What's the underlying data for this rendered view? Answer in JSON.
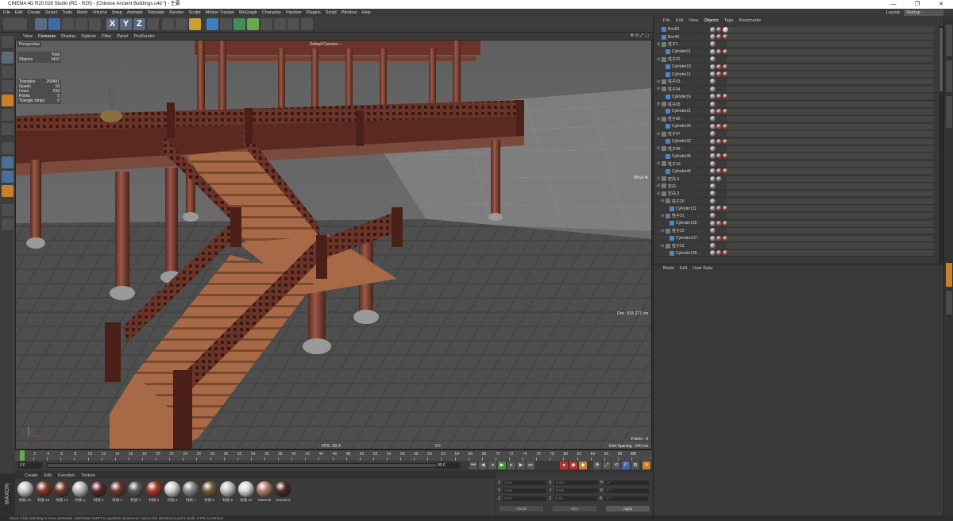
{
  "window": {
    "title": "CINEMA 4D R20.028 Studio (RC - R20) - [Chinese Ancient Buildings.c4d *] - 主要",
    "controls": [
      "—",
      "❐",
      "✕"
    ]
  },
  "menu": {
    "items": [
      "File",
      "Edit",
      "Create",
      "Select",
      "Tools",
      "Mesh",
      "Volume",
      "Snap",
      "Animate",
      "Simulate",
      "Render",
      "Sculpt",
      "Motion Tracker",
      "MoGraph",
      "Character",
      "Pipeline",
      "Plugins",
      "Script",
      "Window",
      "Help"
    ],
    "layout_label": "Layout:",
    "layout_value": "Startup"
  },
  "viewport": {
    "menu": [
      "View",
      "Cameras",
      "Display",
      "Options",
      "Filter",
      "Panel",
      "ProRender"
    ],
    "view_label": "Perspective",
    "camera_label": "Default Camera ◦:◦",
    "stats_header": {
      "label": "Total",
      "objects_label": "Objects",
      "objects_value": "1410"
    },
    "stats": [
      {
        "k": "Triangles",
        "v": "269497"
      },
      {
        "k": "Quads",
        "v": "10"
      },
      {
        "k": "Lines",
        "v": "233"
      },
      {
        "k": "Points",
        "v": "0"
      },
      {
        "k": "Triangle Strips",
        "v": "0"
      }
    ],
    "move_hint": "Move ✥",
    "dist": "Dist : 815.277 cm",
    "fps": "FPS : 83.3",
    "frame_center": "0 F",
    "frame_info": "Frame : 0",
    "grid_spacing": "Grid Spacing : 100 cm"
  },
  "timeline": {
    "ticks": [
      "0",
      "2",
      "4",
      "6",
      "8",
      "10",
      "12",
      "14",
      "16",
      "18",
      "20",
      "22",
      "24",
      "26",
      "28",
      "30",
      "32",
      "34",
      "36",
      "38",
      "40",
      "42",
      "44",
      "46",
      "48",
      "50",
      "52",
      "54",
      "56",
      "58",
      "60",
      "62",
      "64",
      "66",
      "68",
      "70",
      "72",
      "74",
      "76",
      "78",
      "80",
      "82",
      "84",
      "86",
      "88",
      "90"
    ],
    "end_label": "0 F",
    "current_frame": "0 F",
    "start_field": "0 F",
    "min_field": "0 F",
    "max_field": "90 F",
    "end_field": "90 F"
  },
  "materials": {
    "menu": [
      "Create",
      "Edit",
      "Function",
      "Texture"
    ],
    "items": [
      {
        "label": "材质.23",
        "color": "#c9c9c9"
      },
      {
        "label": "材质.16",
        "color": "#7a3e2c"
      },
      {
        "label": "材质.14",
        "color": "#6b3a2a"
      },
      {
        "label": "材质.1",
        "color": "#b9b9b9"
      },
      {
        "label": "材质.2",
        "color": "#5e2a2a"
      },
      {
        "label": "材质.3",
        "color": "#6a3a30"
      },
      {
        "label": "材质.4",
        "color": "#5a5a5a"
      },
      {
        "label": "材质.5",
        "color": "#a33a25"
      },
      {
        "label": "材质.6",
        "color": "#d0d0d0"
      },
      {
        "label": "材质.7",
        "color": "#888888"
      },
      {
        "label": "材质.8",
        "color": "#6e5a3a"
      },
      {
        "label": "材质.9",
        "color": "#c0c0c0"
      },
      {
        "label": "材质.10",
        "color": "#d8d8d8"
      },
      {
        "label": "Material",
        "color": "#b08070"
      },
      {
        "label": "Standard",
        "color": "#4a2a22"
      }
    ]
  },
  "coords": {
    "rows": [
      {
        "axis": "X",
        "pos": "0 cm",
        "size": "0 cm",
        "rot_label": "H",
        "rot": "0 °"
      },
      {
        "axis": "Y",
        "pos": "0 cm",
        "size": "0 cm",
        "rot_label": "P",
        "rot": "0 °"
      },
      {
        "axis": "Z",
        "pos": "0 cm",
        "size": "0 cm",
        "rot_label": "B",
        "rot": "0 °"
      }
    ],
    "mode_left": "World",
    "mode_right": "Size",
    "apply": "Apply"
  },
  "objects": {
    "menu": [
      "File",
      "Edit",
      "View",
      "Objects",
      "Tags",
      "Bookmarks"
    ],
    "active_menu": "Objects",
    "rows": [
      {
        "name": "Box50",
        "indent": 0,
        "kind": "mesh",
        "tags": [
          "#888",
          "#a04040",
          "#d0d0d0"
        ]
      },
      {
        "name": "Box49",
        "indent": 0,
        "kind": "mesh",
        "tags": [
          "#888",
          "#a04040",
          "#7a4a35"
        ]
      },
      {
        "name": "柱子1",
        "indent": 0,
        "kind": "null",
        "tags": [
          "#888"
        ]
      },
      {
        "name": "Cylinder01",
        "indent": 1,
        "kind": "mesh",
        "tags": [
          "#888",
          "#a04040",
          "#7a4a35"
        ]
      },
      {
        "name": "柱子02",
        "indent": 0,
        "kind": "null",
        "tags": [
          "#888"
        ]
      },
      {
        "name": "Cylinder10",
        "indent": 1,
        "kind": "mesh",
        "tags": [
          "#888",
          "#a04040",
          "#7a4a35"
        ]
      },
      {
        "name": "Cylinder11",
        "indent": 1,
        "kind": "mesh",
        "tags": [
          "#888",
          "#a04040",
          "#7a4a35"
        ]
      },
      {
        "name": "柱子03",
        "indent": 0,
        "kind": "null",
        "tags": [
          "#888"
        ]
      },
      {
        "name": "柱子04",
        "indent": 0,
        "kind": "null",
        "tags": [
          "#888"
        ]
      },
      {
        "name": "Cylinder16",
        "indent": 1,
        "kind": "mesh",
        "tags": [
          "#888",
          "#a04040",
          "#7a4a35"
        ]
      },
      {
        "name": "柱子05",
        "indent": 0,
        "kind": "null",
        "tags": [
          "#888"
        ]
      },
      {
        "name": "Cylinder21",
        "indent": 1,
        "kind": "mesh",
        "tags": [
          "#888",
          "#a04040",
          "#7a4a35"
        ]
      },
      {
        "name": "柱子06",
        "indent": 0,
        "kind": "null",
        "tags": [
          "#888"
        ]
      },
      {
        "name": "Cylinder26",
        "indent": 1,
        "kind": "mesh",
        "tags": [
          "#888",
          "#a04040",
          "#7a4a35"
        ]
      },
      {
        "name": "柱子07",
        "indent": 0,
        "kind": "null",
        "tags": [
          "#888"
        ]
      },
      {
        "name": "Cylinder32",
        "indent": 1,
        "kind": "mesh",
        "tags": [
          "#888",
          "#a04040",
          "#7a4a35"
        ]
      },
      {
        "name": "柱子08",
        "indent": 0,
        "kind": "null",
        "tags": [
          "#888"
        ]
      },
      {
        "name": "Cylinder36",
        "indent": 1,
        "kind": "mesh",
        "tags": [
          "#888",
          "#a04040",
          "#7a4a35"
        ]
      },
      {
        "name": "柱子10",
        "indent": 0,
        "kind": "null",
        "tags": [
          "#888"
        ]
      },
      {
        "name": "Cylinder46",
        "indent": 1,
        "kind": "mesh",
        "tags": [
          "#888",
          "#a04040",
          "#7a4a35"
        ]
      },
      {
        "name": "空白.4",
        "indent": 0,
        "kind": "null",
        "tags": [
          "#888",
          "#6a6a6a"
        ]
      },
      {
        "name": "空白",
        "indent": 0,
        "kind": "null",
        "tags": [
          "#888"
        ]
      },
      {
        "name": "空白.3",
        "indent": 0,
        "kind": "null",
        "tags": [
          "#888"
        ]
      },
      {
        "name": "柱子20",
        "indent": 1,
        "kind": "null",
        "tags": [
          "#888"
        ]
      },
      {
        "name": "Cylinder111",
        "indent": 2,
        "kind": "mesh",
        "tags": [
          "#888",
          "#a04040",
          "#7a4a35"
        ]
      },
      {
        "name": "柱子21",
        "indent": 1,
        "kind": "null",
        "tags": [
          "#888"
        ]
      },
      {
        "name": "Cylinder118",
        "indent": 2,
        "kind": "mesh",
        "tags": [
          "#888",
          "#a04040",
          "#7a4a35"
        ]
      },
      {
        "name": "柱子22",
        "indent": 1,
        "kind": "null",
        "tags": [
          "#888"
        ]
      },
      {
        "name": "Cylinder137",
        "indent": 2,
        "kind": "mesh",
        "tags": [
          "#888",
          "#a04040",
          "#7a4a35"
        ]
      },
      {
        "name": "柱子23",
        "indent": 1,
        "kind": "null",
        "tags": [
          "#888"
        ]
      },
      {
        "name": "Cylinder136",
        "indent": 2,
        "kind": "mesh",
        "tags": [
          "#888",
          "#a04040",
          "#7a4a35"
        ]
      }
    ]
  },
  "attributes": {
    "menu": [
      "Mode",
      "Edit",
      "User Data"
    ]
  },
  "status": "Move: Click and drag to move elements. Hold down SHIFT to quantize movement / add to the selection in point mode, CTRL to remove.",
  "colors": {
    "wood": "#8a4a34",
    "wood_dark": "#5a2a22",
    "stair": "#a86a46",
    "stone": "#6a6a6a",
    "accent": "#c8812a",
    "playhead": "#6aa84f"
  }
}
